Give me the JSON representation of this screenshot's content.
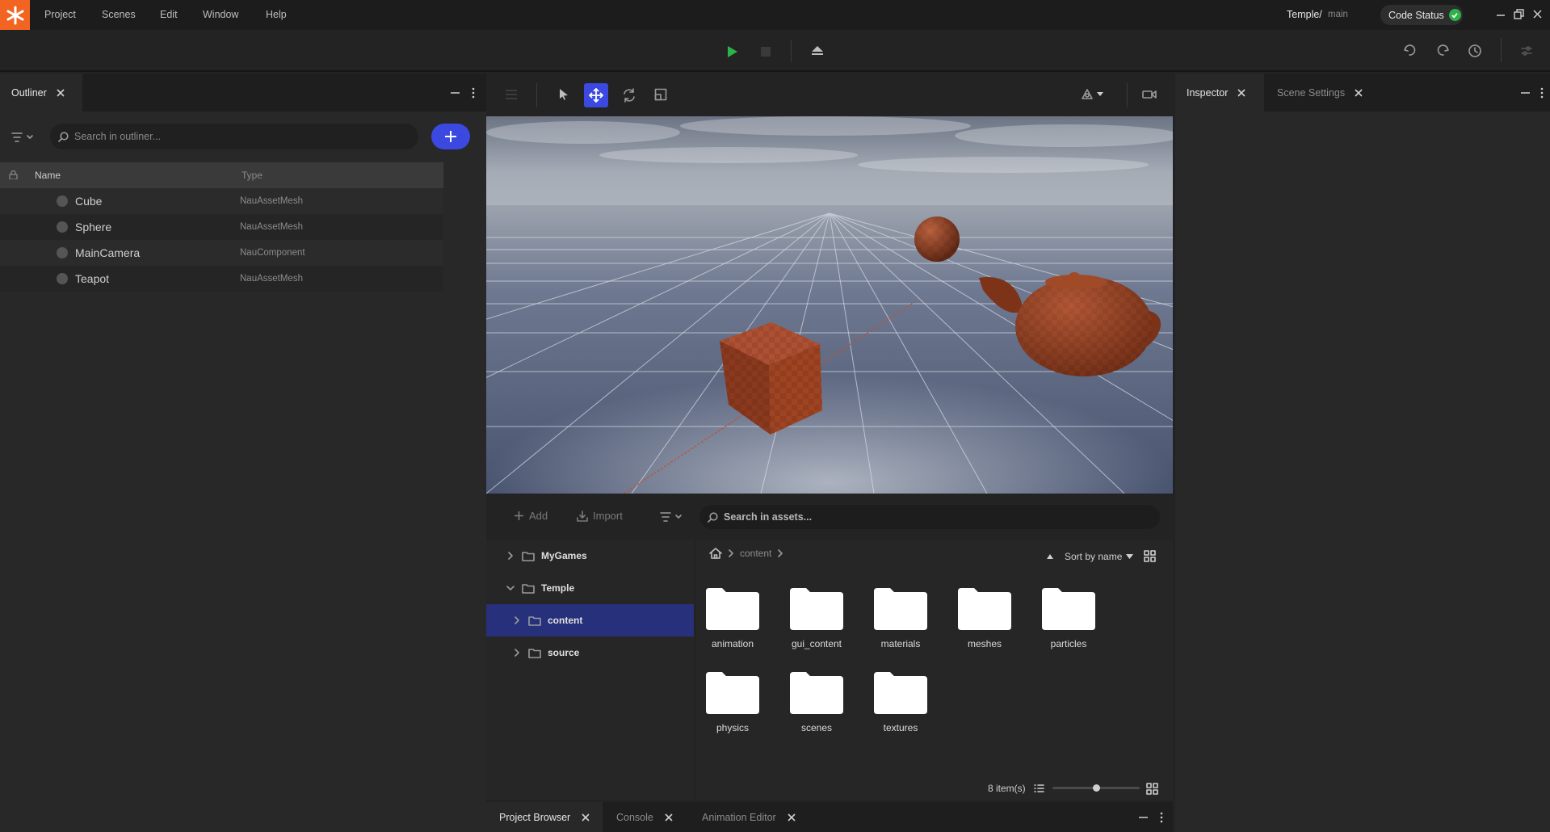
{
  "menubar": {
    "items": [
      "Project",
      "Scenes",
      "Edit",
      "Window",
      "Help"
    ],
    "project_name": "Temple/",
    "branch": "main",
    "code_status_label": "Code Status"
  },
  "outliner": {
    "tab_label": "Outliner",
    "search_placeholder": "Search in outliner...",
    "columns": {
      "name": "Name",
      "type": "Type"
    },
    "rows": [
      {
        "name": "Cube",
        "type": "NauAssetMesh"
      },
      {
        "name": "Sphere",
        "type": "NauAssetMesh"
      },
      {
        "name": "MainCamera",
        "type": "NauComponent"
      },
      {
        "name": "Teapot",
        "type": "NauAssetMesh"
      }
    ]
  },
  "inspector": {
    "tabs": [
      {
        "label": "Inspector",
        "active": true
      },
      {
        "label": "Scene Settings",
        "active": false
      }
    ]
  },
  "viewport": {
    "active_tool": "move",
    "colors": {
      "accent": "#3b49e0",
      "play": "#2bb34a",
      "logo": "#f26422"
    }
  },
  "project_browser": {
    "add_label": "Add",
    "import_label": "Import",
    "search_placeholder": "Search in assets...",
    "tree": [
      {
        "label": "MyGames",
        "expanded": false,
        "selected": false
      },
      {
        "label": "Temple",
        "expanded": true,
        "selected": false
      },
      {
        "label": "content",
        "expanded": false,
        "selected": true
      },
      {
        "label": "source",
        "expanded": false,
        "selected": false
      }
    ],
    "breadcrumb": "content",
    "sort_label": "Sort by name",
    "folders": [
      "animation",
      "gui_content",
      "materials",
      "meshes",
      "particles",
      "physics",
      "scenes",
      "textures"
    ],
    "item_count": "8 item(s)",
    "zoom_fraction": 0.5
  },
  "bottom_tabs": [
    {
      "label": "Project Browser",
      "active": true
    },
    {
      "label": "Console",
      "active": false
    },
    {
      "label": "Animation Editor",
      "active": false
    }
  ]
}
